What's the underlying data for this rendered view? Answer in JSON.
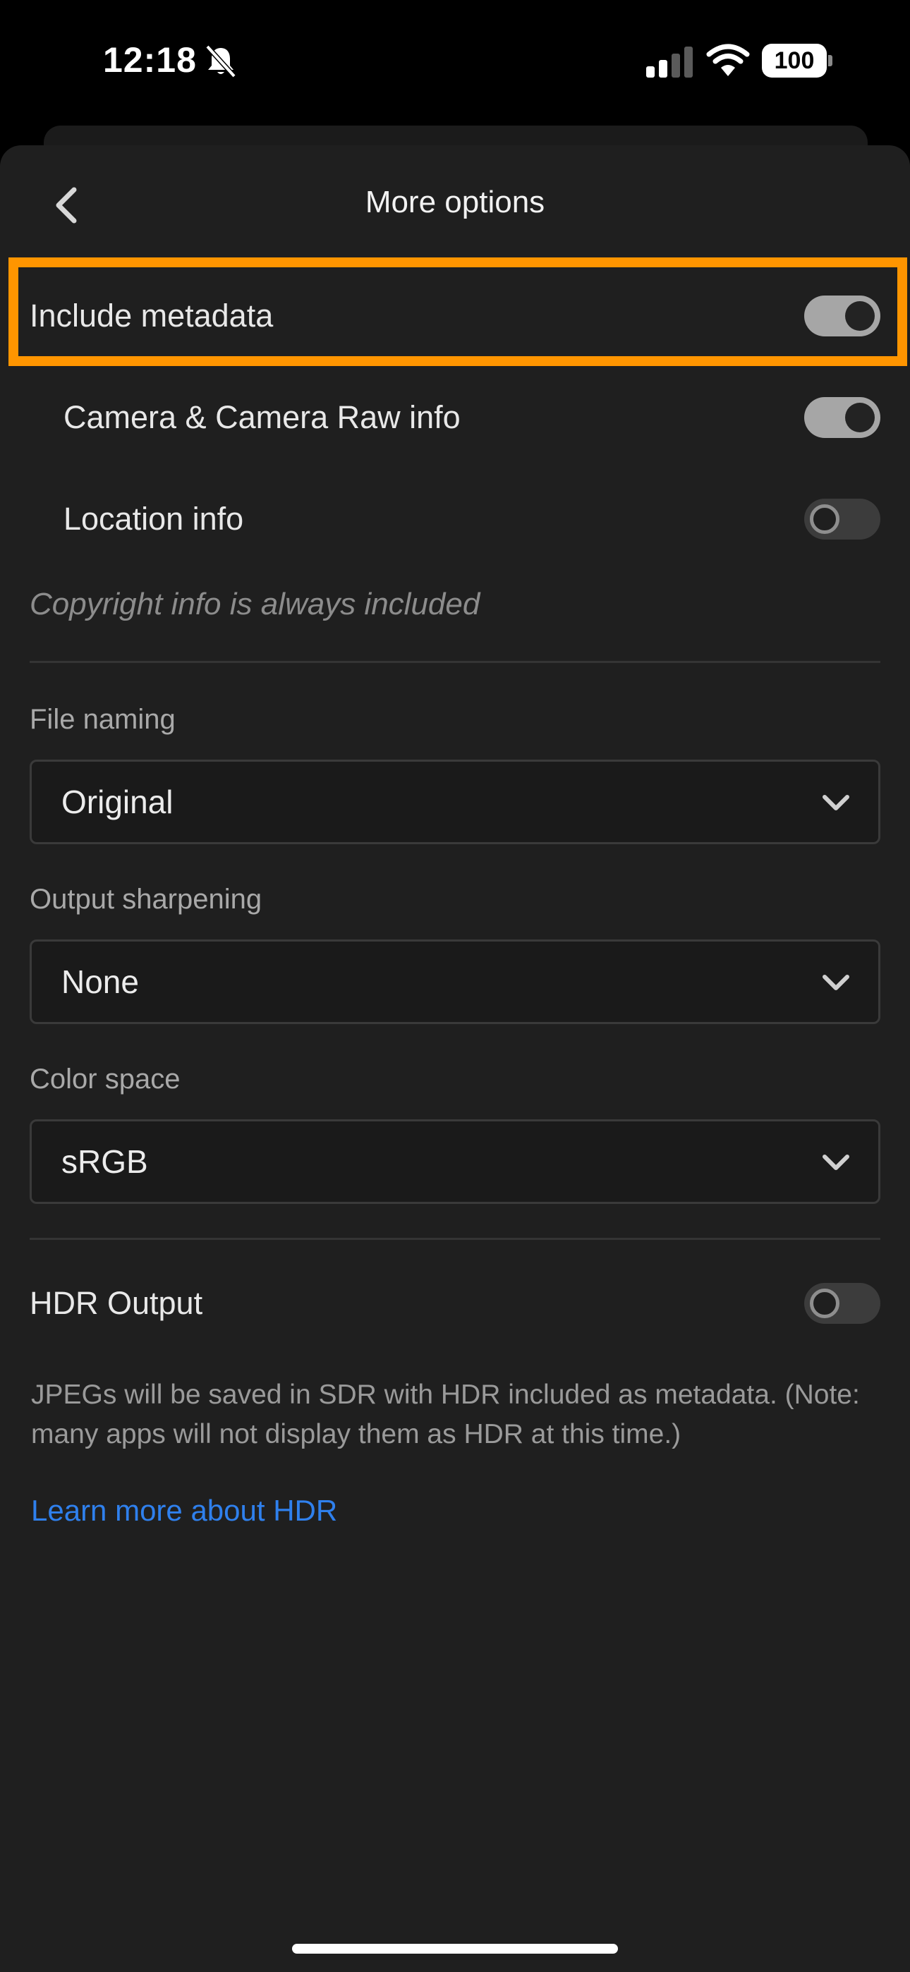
{
  "status_bar": {
    "time": "12:18",
    "battery": "100",
    "icons": [
      "bell-slash-icon",
      "cellular-signal-icon",
      "wifi-icon",
      "battery-icon"
    ]
  },
  "header": {
    "title": "More options",
    "back_icon": "chevron-left-icon"
  },
  "metadata": {
    "include_label": "Include metadata",
    "include_on": true,
    "camera_label": "Camera & Camera Raw info",
    "camera_on": true,
    "location_label": "Location info",
    "location_on": false,
    "copyright_note": "Copyright info is always included"
  },
  "file_naming": {
    "label": "File naming",
    "value": "Original"
  },
  "output_sharpening": {
    "label": "Output sharpening",
    "value": "None"
  },
  "color_space": {
    "label": "Color space",
    "value": "sRGB"
  },
  "hdr": {
    "label": "HDR Output",
    "on": false,
    "description": "JPEGs will be saved in SDR with HDR included as metadata. (Note: many apps will not display them as HDR at this time.)",
    "link": "Learn more about HDR"
  },
  "colors": {
    "highlight": "#ff9500",
    "link": "#2f80ed",
    "background": "#1f1f1f"
  }
}
